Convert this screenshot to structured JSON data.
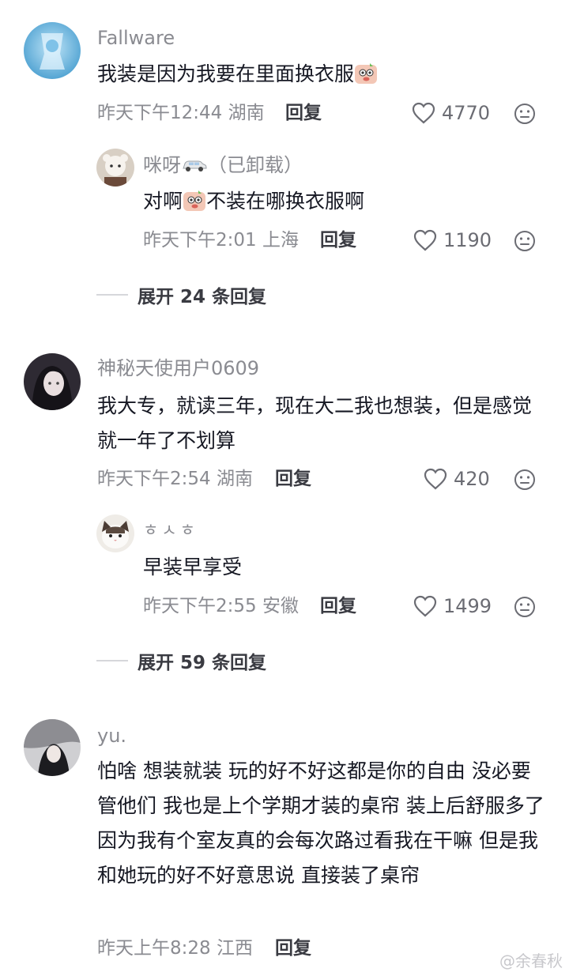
{
  "comments": [
    {
      "username": "Fallware",
      "text": "我装是因为我要在里面换衣服",
      "time": "昨天下午12:44",
      "location": "湖南",
      "reply_label": "回复",
      "likes": "4770",
      "replies": [
        {
          "username": "咪呀",
          "username_suffix": "（已卸载）",
          "text_before": "对啊",
          "text_after": "不装在哪换衣服啊",
          "time": "昨天下午2:01",
          "location": "上海",
          "reply_label": "回复",
          "likes": "1190"
        }
      ],
      "expand_label": "展开 24 条回复"
    },
    {
      "username": "神秘天使用户0609",
      "text": "我大专，就读三年，现在大二我也想装，但是感觉就一年了不划算",
      "time": "昨天下午2:54",
      "location": "湖南",
      "reply_label": "回复",
      "likes": "420",
      "replies": [
        {
          "username": "ㅎㅅㅎ",
          "text": "早装早享受",
          "time": "昨天下午2:55",
          "location": "安徽",
          "reply_label": "回复",
          "likes": "1499"
        }
      ],
      "expand_label": "展开 59 条回复"
    },
    {
      "username": "yu.",
      "text": "怕啥 想装就装 玩的好不好这都是你的自由 没必要管他们 我也是上个学期才装的桌帘 装上后舒服多了因为我有个室友真的会每次路过看我在干嘛 但是我和她玩的好不好意思说 直接装了桌帘",
      "time": "昨天上午8:28",
      "location": "江西",
      "reply_label": "回复"
    }
  ],
  "watermark": "@余春秋",
  "colors": {
    "secondary_text": "#8a8b91",
    "primary_text": "#161823",
    "bold_action": "#3a3b42"
  }
}
